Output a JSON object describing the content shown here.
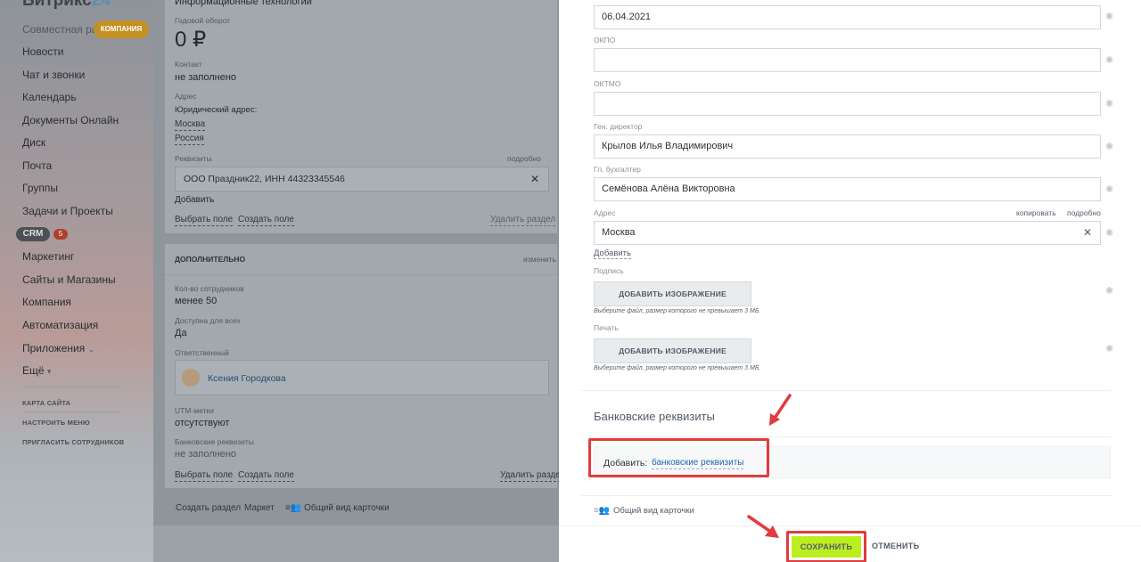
{
  "sidebar": {
    "logo": "Битрикс",
    "logo_accent": "24",
    "items": [
      {
        "label": "Совместная ра"
      },
      {
        "label": "Новости"
      },
      {
        "label": "Чат и звонки"
      },
      {
        "label": "Календарь"
      },
      {
        "label": "Документы Онлайн"
      },
      {
        "label": "Диск"
      },
      {
        "label": "Почта"
      },
      {
        "label": "Группы"
      },
      {
        "label": "Задачи и Проекты"
      },
      {
        "label": "Маркетинг"
      },
      {
        "label": "Сайты и Магазины"
      },
      {
        "label": "Компания"
      },
      {
        "label": "Автоматизация"
      },
      {
        "label": "Приложения"
      },
      {
        "label": "Ещё"
      }
    ],
    "crm_label": "CRM",
    "crm_count": "5",
    "company_badge": "КОМПАНИЯ",
    "footer_links": [
      "КАРТА САЙТА",
      "НАСТРОИТЬ МЕНЮ",
      "ПРИГЛАСИТЬ СОТРУДНИКОВ"
    ]
  },
  "card": {
    "industry_value": "Информационные технологии",
    "revenue_label": "Годовой оборот",
    "revenue_value": "0 ₽",
    "contact_label": "Контакт",
    "contact_value": "не заполнено",
    "address_label": "Адрес",
    "legal_address_label": "Юридический адрес:",
    "legal_city": "Москва",
    "legal_country": "Россия",
    "requisites_label": "Реквизиты",
    "requisites_more": "подробно",
    "requisites_value": "ООО Праздник22, ИНН 44323345546",
    "add_link": "Добавить",
    "choose_field": "Выбрать поле",
    "create_field": "Создать поле",
    "delete_section": "Удалить раздел",
    "extra_title": "ДОПОЛНИТЕЛЬНО",
    "extra_change": "изменить",
    "employees_label": "Кол-во сотрудников",
    "employees_value": "менее 50",
    "available_label": "Доступна для всех",
    "available_value": "Да",
    "responsible_label": "Ответственный",
    "responsible_name": "Ксения Городкова",
    "utm_label": "UTM-метки",
    "utm_value": "отсутствуют",
    "bank_label": "Банковские реквизиты",
    "bank_value": "не заполнено",
    "choose_field_2": "Выбрать поле",
    "create_field_2": "Создать поле",
    "delete_section_2": "Удалить разде",
    "footer_create_section": "Создать раздел",
    "footer_market": "Маркет",
    "footer_card_view": "Общий вид карточки"
  },
  "form": {
    "date_value": "06.04.2021",
    "okpo_label": "ОКПО",
    "okpo_value": "",
    "oktmo_label": "ОКТМО",
    "oktmo_value": "",
    "director_label": "Ген. директор",
    "director_value": "Крылов Илья Владимирович",
    "accountant_label": "Гл. бухгалтер",
    "accountant_value": "Семёнова Алёна Викторовна",
    "address_label": "Адрес",
    "copy_link": "копировать",
    "detail_link": "подробно",
    "address_value": "Москва",
    "add_link": "Добавить",
    "signature_label": "Подпись",
    "add_image": "ДОБАВИТЬ ИЗОБРАЖЕНИЕ",
    "file_hint": "Выберите файл, размер которого не превышает 3 МБ.",
    "stamp_label": "Печать",
    "bank_title": "Банковские реквизиты",
    "bank_add_prefix": "Добавить:",
    "bank_add_link": "банковские реквизиты",
    "card_view": "Общий вид карточки"
  },
  "actions": {
    "save": "СОХРАНИТЬ",
    "cancel": "ОТМЕНИТЬ"
  },
  "colors": {
    "save_button": "#bbed21",
    "highlight_frame": "#e23b3b",
    "company_badge": "#c39023",
    "link_blue": "#2067b0"
  }
}
